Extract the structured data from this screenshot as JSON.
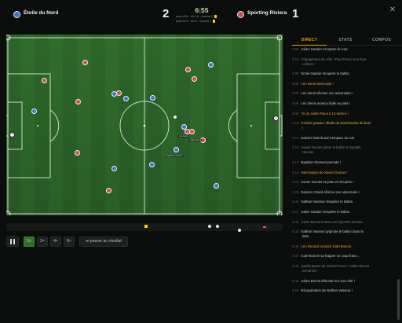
{
  "header": {
    "home_team": "Étoile du Nord",
    "away_team": "Sporting Riviera",
    "home_score": "2",
    "away_score": "1",
    "clock": "6:55",
    "stat_line_1": "poss 49% · tirs 18 · corners 2",
    "stat_line_2": "poss 51% · tirs 6 · corners 2",
    "home_color": "#3d6fd1",
    "away_color": "#d8474d"
  },
  "pitch_tags": {
    "tag1": "Léo Denis",
    "tag2": "Julien Roux",
    "tag3": "Baptiste Clément"
  },
  "controls": {
    "speed_1": "1×",
    "speed_2": "2×",
    "speed_4": "4×",
    "speed_8": "8×",
    "skip_label": "⏭ passer au résultat"
  },
  "panel": {
    "tabs": [
      "DIRECT",
      "STATS",
      "COMPOS"
    ],
    "events": [
      {
        "t": "5:56",
        "text": "Julien Gautier s'empare du cuir.",
        "kind": "normal"
      },
      {
        "t": "5:53",
        "text": "Changement de côté ! Paul Perez vers Noé",
        "kind": "dim"
      },
      {
        "t": "",
        "text": "Lefèvre !",
        "kind": "dim"
      },
      {
        "t": "5:55",
        "text": "Émile Gautier récupère le ballon.",
        "kind": "normal"
      },
      {
        "t": "6:03",
        "text": "Léo Denis intercepte !",
        "kind": "hl"
      },
      {
        "t": "6:04",
        "text": "Léo Denis élimine son adversaire !",
        "kind": "normal"
      },
      {
        "t": "6:06",
        "text": "Léo Denis avance balle au pied !",
        "kind": "normal"
      },
      {
        "t": "6:08",
        "text": "Tir de Julien Roux à 13 mètres !",
        "kind": "hl"
      },
      {
        "t": "6:10",
        "text": "C'est le poteau ! Étoile du Nord touche du bois",
        "kind": "gold"
      },
      {
        "t": "",
        "text": "!",
        "kind": "gold"
      },
      {
        "t": "6:13",
        "text": "Damien Marchand s'empare du cuir.",
        "kind": "normal"
      },
      {
        "t": "6:15",
        "text": "Xavier Dumas glisse le ballon à Quentin",
        "kind": "dim"
      },
      {
        "t": "",
        "text": "Nicolas.",
        "kind": "dim"
      },
      {
        "t": "6:17",
        "text": "Baptiste Clement percute !",
        "kind": "normal"
      },
      {
        "t": "6:19",
        "text": "Interception de Xavier Dumas !",
        "kind": "hl"
      },
      {
        "t": "6:21",
        "text": "Xavier Dumas se jette et récupère !",
        "kind": "normal"
      },
      {
        "t": "6:23",
        "text": "Damien Girard élimine son adversaire !",
        "kind": "normal"
      },
      {
        "t": "6:25",
        "text": "Nathan Vasseur récupère le ballon.",
        "kind": "normal"
      },
      {
        "t": "6:27",
        "text": "Julien Gautier récupère le ballon.",
        "kind": "normal"
      },
      {
        "t": "6:30",
        "text": "Julien Benoit écarte vers Quentin Nicolas.",
        "kind": "dim"
      },
      {
        "t": "6:32",
        "text": "Nathan Vasseur grignote le ballon dans la",
        "kind": "normal"
      },
      {
        "t": "",
        "text": "lutte.",
        "kind": "normal"
      },
      {
        "t": "6:35",
        "text": "Léo Renard ceinture Gaël Bonnin.",
        "kind": "hl"
      },
      {
        "t": "6:37",
        "text": "Gaël Bonnin va frapper ce coup franc…",
        "kind": "normal"
      },
      {
        "t": "6:39",
        "text": "Quelle passe de Gabriel Perez ! Julien Benoit",
        "kind": "dim"
      },
      {
        "t": "",
        "text": "est lancé !",
        "kind": "dim"
      },
      {
        "t": "6:42",
        "text": "Julien Benoit déborde sur son côté !",
        "kind": "normal"
      },
      {
        "t": "6:50",
        "text": "Récupération de Nathan Vasseur !",
        "kind": "normal"
      }
    ]
  }
}
